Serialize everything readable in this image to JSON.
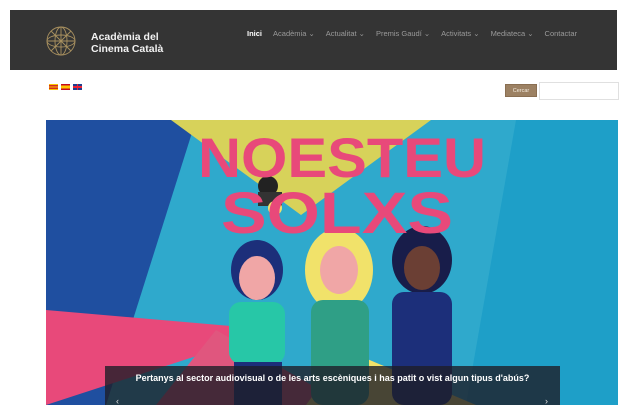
{
  "header": {
    "brand_line1": "Acadèmia del",
    "brand_line2": "Cinema Català",
    "logo_icon": "geodesic-globe-icon",
    "nav": [
      {
        "label": "Inici",
        "active": true
      },
      {
        "label": "Acadèmia ⌄",
        "active": false
      },
      {
        "label": "Actualitat ⌄",
        "active": false
      },
      {
        "label": "Premis Gaudí ⌄",
        "active": false
      },
      {
        "label": "Activitats ⌄",
        "active": false
      },
      {
        "label": "Mediateca ⌄",
        "active": false
      },
      {
        "label": "Contactar",
        "active": false
      }
    ]
  },
  "languages": [
    "ca",
    "es",
    "en"
  ],
  "search": {
    "button_label": "Cercar",
    "placeholder": ""
  },
  "hero": {
    "headline_line1": "NOESTEU",
    "headline_line2": "SOLXS",
    "caption": "Pertanys al sector audiovisual o de les arts escèniques i has patit o vist algun tipus d'abús?",
    "colors": {
      "background": "#2fa9cc",
      "headline": "#e8497a",
      "accent_yellow": "#d7d25a",
      "accent_pink": "#e8497a",
      "accent_navy": "#1c2f7a"
    }
  }
}
